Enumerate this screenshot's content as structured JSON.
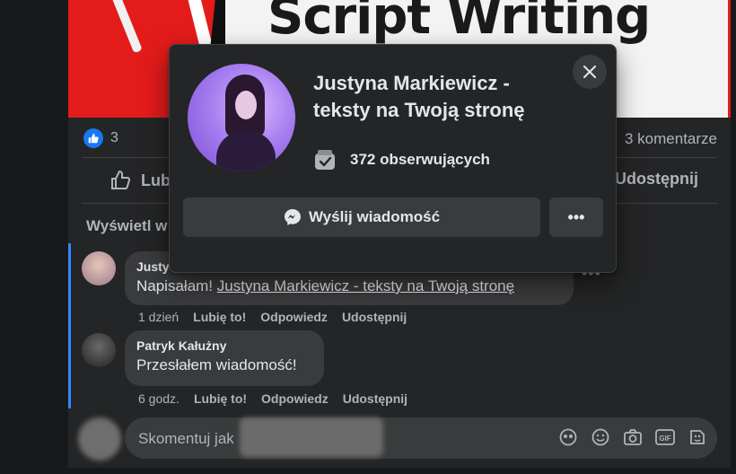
{
  "banner": {
    "text": "Script Writing"
  },
  "post": {
    "reaction_count": "3",
    "comments_count": "3 komentarze",
    "like_label": "Lubię",
    "share_label": "Udostępnij",
    "view_more": "Wyświetl w"
  },
  "comments": [
    {
      "author": "Justy",
      "text_prefix": "Napisałam! ",
      "link": "Justyna Markiewicz - teksty na Twoją stronę",
      "time": "1 dzień",
      "like": "Lubię to!",
      "reply": "Odpowiedz",
      "share": "Udostępnij"
    },
    {
      "author": "Patryk Kałużny",
      "text": "Przesłałem wiadomość!",
      "time": "6 godz.",
      "like": "Lubię to!",
      "reply": "Odpowiedz",
      "share": "Udostępnij"
    }
  ],
  "composer": {
    "placeholder": "Skomentuj jak"
  },
  "popup": {
    "name": "Justyna Markiewicz - teksty na Twoją stronę",
    "followers": "372 obserwujących",
    "message_button": "Wyślij wiadomość",
    "more_button": "•••"
  },
  "colors": {
    "accent": "#2d88ff",
    "like_blue": "#1877f2",
    "bg": "#18191a",
    "card": "#242526"
  }
}
